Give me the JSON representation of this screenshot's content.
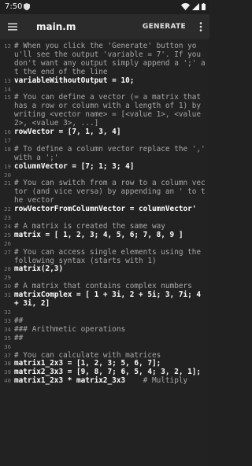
{
  "status_bar": {
    "time": "7:50",
    "icons": [
      "shield-icon",
      "wifi-icon",
      "signal-icon",
      "battery-icon"
    ]
  },
  "app_bar": {
    "menu_icon": "hamburger-menu-icon",
    "title": "main.m",
    "generate_label": "GENERATE",
    "more_icon": "more-vert-icon"
  },
  "editor": {
    "lines": [
      {
        "num": "12",
        "kind": "comment",
        "text": "# When you click the 'Generate' button you'll see the output 'variable = 7'. If you don't want any output simply append a ';' at the end of the line"
      },
      {
        "num": "13",
        "kind": "stmt",
        "text": "variableWithoutOutput = 10;"
      },
      {
        "num": "14",
        "kind": "blank",
        "text": ""
      },
      {
        "num": "15",
        "kind": "comment",
        "text": "# You can define a vector (= a matrix that has a row or column with a length of 1) by writing <vector name> = [<value 1>, <value 2>, <value 3>, ...]"
      },
      {
        "num": "16",
        "kind": "stmt",
        "text": "rowVector = [7, 1, 3, 4]"
      },
      {
        "num": "17",
        "kind": "blank",
        "text": ""
      },
      {
        "num": "18",
        "kind": "comment",
        "text": "# To define a column vector replace the ',' with a ';'"
      },
      {
        "num": "19",
        "kind": "stmt",
        "text": "columnVector = [7; 1; 3; 4]"
      },
      {
        "num": "20",
        "kind": "blank",
        "text": ""
      },
      {
        "num": "21",
        "kind": "comment",
        "text": "# You can switch from a row to a column vector (and vice versa) by appending an ' to the vector"
      },
      {
        "num": "22",
        "kind": "stmt",
        "text": "rowVectorFromColumnVector = columnVector'"
      },
      {
        "num": "23",
        "kind": "blank",
        "text": ""
      },
      {
        "num": "24",
        "kind": "comment",
        "text": "# A matrix is created the same way"
      },
      {
        "num": "25",
        "kind": "stmt",
        "text": "matrix = [ 1, 2, 3; 4, 5, 6; 7, 8, 9 ]"
      },
      {
        "num": "26",
        "kind": "blank",
        "text": ""
      },
      {
        "num": "27",
        "kind": "comment",
        "text": "# You can access single elements using the following syntax (starts with 1)"
      },
      {
        "num": "28",
        "kind": "stmt",
        "text": "matrix(2,3)"
      },
      {
        "num": "29",
        "kind": "blank",
        "text": ""
      },
      {
        "num": "30",
        "kind": "comment",
        "text": "# A matrix that contains complex numbers"
      },
      {
        "num": "31",
        "kind": "stmt",
        "text": "matrixComplex = [ 1 + 3i, 2 + 5i; 3, 7i; 4 + 3i, 2]"
      },
      {
        "num": "32",
        "kind": "blank",
        "text": ""
      },
      {
        "num": "33",
        "kind": "comment",
        "text": "##"
      },
      {
        "num": "34",
        "kind": "comment",
        "text": "### Arithmetic operations"
      },
      {
        "num": "35",
        "kind": "comment",
        "text": "##"
      },
      {
        "num": "36",
        "kind": "blank",
        "text": ""
      },
      {
        "num": "37",
        "kind": "comment",
        "text": "# You can calculate with matrices"
      },
      {
        "num": "38",
        "kind": "stmt",
        "text": "matrix1_2x3 = [1, 2, 3; 5, 6, 7];"
      },
      {
        "num": "39",
        "kind": "stmt",
        "text": "matrix2_3x3 = [9, 8, 7; 6, 5, 4; 3, 2, 1];"
      },
      {
        "num": "40",
        "kind": "mixed",
        "text": "matrix1_2x3 * matrix2_3x3",
        "comment": "    # Multiply"
      }
    ]
  }
}
